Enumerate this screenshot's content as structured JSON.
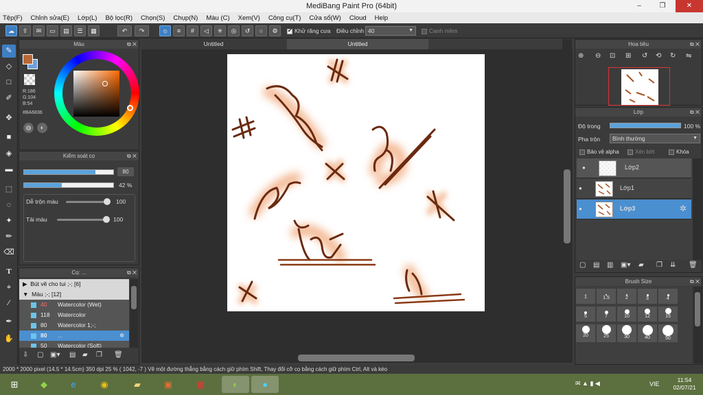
{
  "window": {
    "title": "MediBang Paint Pro (64bit)",
    "minimize": "–",
    "maximize": "❐",
    "close": "✕"
  },
  "menu": [
    "Tệp(F)",
    "Chỉnh sửa(E)",
    "Lớp(L)",
    "Bộ lọc(R)",
    "Chọn(S)",
    "Chụp(N)",
    "Màu (C)",
    "Xem(V)",
    "Công cụ(T)",
    "Cửa sổ(W)",
    "Cloud",
    "Help"
  ],
  "toolbar": {
    "antialias_label": "Khử răng cưa",
    "correction_label": "Điều chỉnh",
    "correction_value": "40",
    "snap_label": "Canh mềm"
  },
  "tabs": [
    "Untitled",
    "Untitled"
  ],
  "color_panel": {
    "title": "Màu",
    "r": "R:186",
    "g": "G:104",
    "b": "B:54",
    "hex": "#BA6836",
    "primary": "#BA6836"
  },
  "brush_control": {
    "title": "Kiểm soát cọ",
    "size_value": "80",
    "opacity_value": "42 %",
    "size_fill": 0.8,
    "opacity_fill": 0.42,
    "blend_label": "Dễ trộn màu",
    "blend_value": "100",
    "amount_label": "Tải màu",
    "amount_value": "100"
  },
  "brush_panel": {
    "title": "Cọ: ...",
    "groups": [
      {
        "label": "Bút vẽ cho tui ;-; [6]"
      },
      {
        "label": "Màu ;-; [12]"
      }
    ],
    "items": [
      {
        "size": "40",
        "name": "Watercolor (Wet)"
      },
      {
        "size": "118",
        "name": "Watercolor"
      },
      {
        "size": "80",
        "name": "Watercolor 1;-;"
      },
      {
        "size": "80",
        "name": "..."
      },
      {
        "size": "50",
        "name": "Watercolor (Soft)"
      }
    ]
  },
  "navigator": {
    "title": "Hoa tiêu"
  },
  "layers": {
    "title": "Lớp",
    "opacity_label": "Độ trong",
    "opacity_value": "100 %",
    "opacity_fill": 1.0,
    "blend_label": "Pha trộn",
    "blend_value": "Bình thường",
    "protect_alpha": "Bảo vệ alpha",
    "clipping": "Xén bớt",
    "lock": "Khóa",
    "items": [
      {
        "name": "Lớp2"
      },
      {
        "name": "Lớp1"
      },
      {
        "name": "Lớp3"
      }
    ]
  },
  "brush_size": {
    "title": "Brush Size",
    "sizes": [
      "1",
      "1.5",
      "2",
      "3",
      "4",
      "5",
      "7",
      "10",
      "12",
      "15",
      "20",
      "25",
      "30",
      "40",
      "50"
    ]
  },
  "status": {
    "text": "2000 * 2000 pixel   (14.5 * 14.5cm)   350 dpi   25 %   ( 1042, -7 )   Vẽ một đường thẳng bằng cách giữ phím Shift, Thay đổi cỡ cọ bằng cách giữ phím Ctrl, Alt và kéo"
  },
  "taskbar": {
    "lang": "VIE",
    "time": "11:54",
    "date": "02/07/21"
  }
}
